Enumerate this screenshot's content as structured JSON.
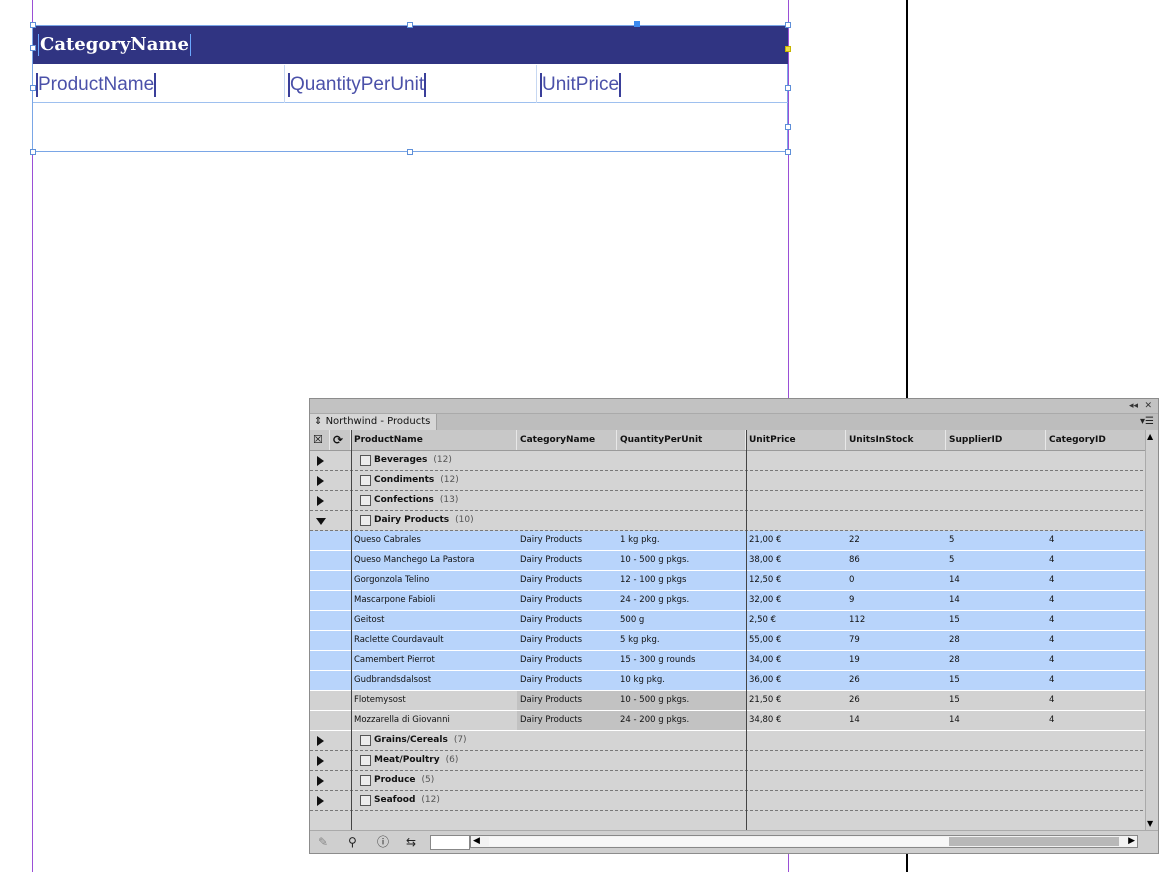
{
  "template": {
    "category_field": "CategoryName",
    "row_fields": [
      "ProductName",
      "QuantityPerUnit",
      "UnitPrice"
    ]
  },
  "panel": {
    "tab_title": "Northwind - Products",
    "tab_prefix_icon": "sort-arrows-icon",
    "columns": [
      "ProductName",
      "CategoryName",
      "QuantityPerUnit",
      "UnitPrice",
      "UnitsInStock",
      "SupplierID",
      "CategoryID"
    ],
    "groups": [
      {
        "label": "Beverages",
        "count": "(12)",
        "expanded": false
      },
      {
        "label": "Condiments",
        "count": "(12)",
        "expanded": false
      },
      {
        "label": "Confections",
        "count": "(13)",
        "expanded": false
      },
      {
        "label": "Dairy Products",
        "count": "(10)",
        "expanded": true
      }
    ],
    "dairy_rows": [
      {
        "ProductName": "Queso Cabrales",
        "CategoryName": "Dairy Products",
        "QuantityPerUnit": "1 kg pkg.",
        "UnitPrice": "21,00 €",
        "UnitsInStock": "22",
        "SupplierID": "5",
        "CategoryID": "4",
        "selected": true
      },
      {
        "ProductName": "Queso Manchego La Pastora",
        "CategoryName": "Dairy Products",
        "QuantityPerUnit": "10 - 500 g pkgs.",
        "UnitPrice": "38,00 €",
        "UnitsInStock": "86",
        "SupplierID": "5",
        "CategoryID": "4",
        "selected": true
      },
      {
        "ProductName": "Gorgonzola Telino",
        "CategoryName": "Dairy Products",
        "QuantityPerUnit": "12 - 100 g pkgs",
        "UnitPrice": "12,50 €",
        "UnitsInStock": "0",
        "SupplierID": "14",
        "CategoryID": "4",
        "selected": true
      },
      {
        "ProductName": "Mascarpone Fabioli",
        "CategoryName": "Dairy Products",
        "QuantityPerUnit": "24 - 200 g pkgs.",
        "UnitPrice": "32,00 €",
        "UnitsInStock": "9",
        "SupplierID": "14",
        "CategoryID": "4",
        "selected": true
      },
      {
        "ProductName": "Geitost",
        "CategoryName": "Dairy Products",
        "QuantityPerUnit": "500 g",
        "UnitPrice": "2,50 €",
        "UnitsInStock": "112",
        "SupplierID": "15",
        "CategoryID": "4",
        "selected": true
      },
      {
        "ProductName": "Raclette Courdavault",
        "CategoryName": "Dairy Products",
        "QuantityPerUnit": "5 kg pkg.",
        "UnitPrice": "55,00 €",
        "UnitsInStock": "79",
        "SupplierID": "28",
        "CategoryID": "4",
        "selected": true
      },
      {
        "ProductName": "Camembert Pierrot",
        "CategoryName": "Dairy Products",
        "QuantityPerUnit": "15 - 300 g rounds",
        "UnitPrice": "34,00 €",
        "UnitsInStock": "19",
        "SupplierID": "28",
        "CategoryID": "4",
        "selected": true
      },
      {
        "ProductName": "Gudbrandsdalsost",
        "CategoryName": "Dairy Products",
        "QuantityPerUnit": "10 kg pkg.",
        "UnitPrice": "36,00 €",
        "UnitsInStock": "26",
        "SupplierID": "15",
        "CategoryID": "4",
        "selected": true
      },
      {
        "ProductName": "Flotemysost",
        "CategoryName": "Dairy Products",
        "QuantityPerUnit": "10 - 500 g pkgs.",
        "UnitPrice": "21,50 €",
        "UnitsInStock": "26",
        "SupplierID": "15",
        "CategoryID": "4",
        "selected": false
      },
      {
        "ProductName": "Mozzarella di Giovanni",
        "CategoryName": "Dairy Products",
        "QuantityPerUnit": "24 - 200 g pkgs.",
        "UnitPrice": "34,80 €",
        "UnitsInStock": "14",
        "SupplierID": "14",
        "CategoryID": "4",
        "selected": false
      }
    ],
    "groups_after": [
      {
        "label": "Grains/Cereals",
        "count": "(7)",
        "expanded": false
      },
      {
        "label": "Meat/Poultry",
        "count": "(6)",
        "expanded": false
      },
      {
        "label": "Produce",
        "count": "(5)",
        "expanded": false
      },
      {
        "label": "Seafood",
        "count": "(12)",
        "expanded": false
      }
    ],
    "bottom_icons": [
      "pencil-icon",
      "search-icon",
      "info-icon",
      "swap-arrows-icon"
    ],
    "colors": {
      "selected_row": "#b8d4fb",
      "category_bar": "#303482"
    }
  }
}
